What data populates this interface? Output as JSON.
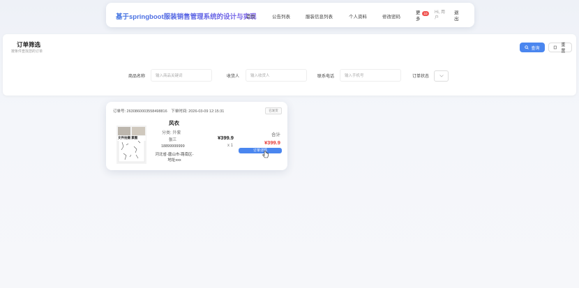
{
  "header": {
    "brand": "基于springboot服装销售管理系统的设计与实现",
    "nav": [
      "首页",
      "公告列表",
      "服装信息列表",
      "个人资料",
      "修改密码"
    ],
    "more": "更多",
    "badge": "10",
    "greeting": "Hi, 用户",
    "logout": "退出"
  },
  "filter": {
    "title": "订单筛选",
    "subtitle": "按条件查找您的订单",
    "query_label": "查询",
    "reset_label": "重置",
    "fields": [
      {
        "label": "商品名称",
        "placeholder": "输入商品关键词"
      },
      {
        "label": "收货人",
        "placeholder": "输入收货人"
      },
      {
        "label": "联系电话",
        "placeholder": "输入手机号"
      },
      {
        "label": "订单状态",
        "value": ""
      }
    ]
  },
  "orders": [
    {
      "order_no_label": "订单号: 2630860003558498816",
      "time_label": "下单时间: 2026-03-09 12:15:31",
      "status": "已发货",
      "thumb_text": "文件拍摄 素图",
      "name": "风衣",
      "category": "分类: 外套",
      "person": "张三",
      "phone": "18899999999",
      "address": "河北省-唐山市-路南区-地址xxx",
      "unit_price": "¥399.9",
      "quantity": "x 1",
      "total_label": "合计",
      "total": "¥399.9",
      "detail_label": "订单详情"
    }
  ],
  "colors": {
    "primary": "#4a86ef",
    "price_red": "#e53935",
    "badge_red": "#ef5350"
  }
}
